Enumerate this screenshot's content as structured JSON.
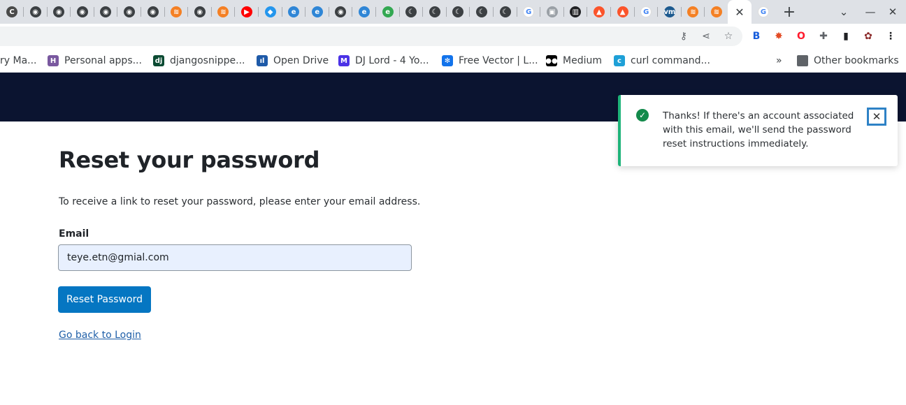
{
  "browser": {
    "tabs": [
      {
        "icon": "c-app-icon",
        "color": "#4a4a4a",
        "glyph": "C"
      },
      {
        "icon": "globe-icon",
        "color": "#3c4043",
        "glyph": "◉"
      },
      {
        "icon": "globe-icon",
        "color": "#3c4043",
        "glyph": "◉"
      },
      {
        "icon": "globe-icon",
        "color": "#3c4043",
        "glyph": "◉"
      },
      {
        "icon": "globe-icon",
        "color": "#3c4043",
        "glyph": "◉"
      },
      {
        "icon": "globe-icon",
        "color": "#3c4043",
        "glyph": "◉"
      },
      {
        "icon": "globe-icon",
        "color": "#3c4043",
        "glyph": "◉"
      },
      {
        "icon": "stackoverflow-icon",
        "color": "#f48024",
        "glyph": "≋"
      },
      {
        "icon": "globe-icon",
        "color": "#3c4043",
        "glyph": "◉"
      },
      {
        "icon": "stackoverflow-icon",
        "color": "#f48024",
        "glyph": "≋"
      },
      {
        "icon": "youtube-icon",
        "color": "#ff0000",
        "glyph": "▶"
      },
      {
        "icon": "docker-icon",
        "color": "#2496ed",
        "glyph": "◆"
      },
      {
        "icon": "edge-icon",
        "color": "#2f86d6",
        "glyph": "e"
      },
      {
        "icon": "edge-icon",
        "color": "#2f86d6",
        "glyph": "e"
      },
      {
        "icon": "globe-icon",
        "color": "#3c4043",
        "glyph": "◉"
      },
      {
        "icon": "edge-icon",
        "color": "#2f86d6",
        "glyph": "e"
      },
      {
        "icon": "edge-colored-icon",
        "color": "#33a852",
        "glyph": "e"
      },
      {
        "icon": "crescent-icon",
        "color": "#3c4043",
        "glyph": "☾"
      },
      {
        "icon": "crescent-icon",
        "color": "#3c4043",
        "glyph": "☾"
      },
      {
        "icon": "crescent-icon",
        "color": "#3c4043",
        "glyph": "☾"
      },
      {
        "icon": "crescent-icon",
        "color": "#3c4043",
        "glyph": "☾"
      },
      {
        "icon": "crescent-icon",
        "color": "#3c4043",
        "glyph": "☾"
      },
      {
        "icon": "google-icon",
        "color": "#ffffff",
        "glyph": "G"
      },
      {
        "icon": "cube-icon",
        "color": "#9aa0a6",
        "glyph": "▣"
      },
      {
        "icon": "barcode-icon",
        "color": "#202124",
        "glyph": "▥"
      },
      {
        "icon": "brave-icon",
        "color": "#fb542b",
        "glyph": "▲"
      },
      {
        "icon": "brave-icon",
        "color": "#fb542b",
        "glyph": "▲"
      },
      {
        "icon": "google-icon",
        "color": "#ffffff",
        "glyph": "G"
      },
      {
        "icon": "vmware-icon",
        "color": "#1d5a8f",
        "glyph": "vm"
      },
      {
        "icon": "stackoverflow-icon",
        "color": "#f48024",
        "glyph": "≋"
      },
      {
        "icon": "stackoverflow-icon",
        "color": "#f48024",
        "glyph": "≋"
      }
    ],
    "active_tab_close": "✕",
    "last_tab": {
      "icon": "google-icon",
      "glyph": "G"
    },
    "new_tab": "+",
    "tab_search": "⌄",
    "minimize": "—",
    "close_window": "✕",
    "extensions": [
      {
        "icon": "bitwarden-icon",
        "color": "#175ddc",
        "glyph": "B"
      },
      {
        "icon": "colorzilla-icon",
        "color": "#e34c26",
        "glyph": "✸"
      },
      {
        "icon": "opera-icon",
        "color": "#ff1b2d",
        "glyph": "O"
      },
      {
        "icon": "puzzle-icon",
        "color": "#5f6368",
        "glyph": "✚"
      },
      {
        "icon": "sidepanel-icon",
        "color": "#202124",
        "glyph": "▮"
      },
      {
        "icon": "profile-icon",
        "color": "#8b2a2a",
        "glyph": "✿"
      },
      {
        "icon": "menu-dots-icon",
        "color": "#202124",
        "glyph": "⋮"
      }
    ],
    "bookmarks": [
      {
        "label": "ry Ma...",
        "icon": "",
        "color": ""
      },
      {
        "label": "Personal apps...",
        "icon": "heroku-icon",
        "color": "#79589f",
        "glyph": "H"
      },
      {
        "label": "djangosnippe...",
        "icon": "django-icon",
        "color": "#0c4b33",
        "glyph": "dj"
      },
      {
        "label": "Open Drive",
        "icon": "open-drive-icon",
        "color": "#1e5aa8",
        "glyph": "ıl"
      },
      {
        "label": "DJ Lord - 4 Yo...",
        "icon": "m-logo-icon",
        "color": "#4b32e6",
        "glyph": "M"
      },
      {
        "label": "Free Vector | L...",
        "icon": "freepik-icon",
        "color": "#1273eb",
        "glyph": "✻"
      },
      {
        "label": "Medium",
        "icon": "medium-icon",
        "color": "#000000",
        "glyph": "●●"
      },
      {
        "label": "curl command...",
        "icon": "curl-icon",
        "color": "#1ea0d7",
        "glyph": "c"
      }
    ],
    "bookmarks_overflow": "»",
    "other_bookmarks": "Other bookmarks"
  },
  "page": {
    "title": "Reset your password",
    "lead": "To receive a link to reset your password, please enter your email address.",
    "email_label": "Email",
    "email_value": "teye.etn@gmial.com",
    "submit_label": "Reset Password",
    "back_link": "Go back to Login",
    "header_color": "#0b1430",
    "button_color": "#0576c2"
  },
  "toast": {
    "message": "Thanks! If there's an account associated with this email, we'll send the password reset instructions immediately.",
    "close_glyph": "✕",
    "check_glyph": "✓",
    "accent_color": "#1fb47a"
  }
}
